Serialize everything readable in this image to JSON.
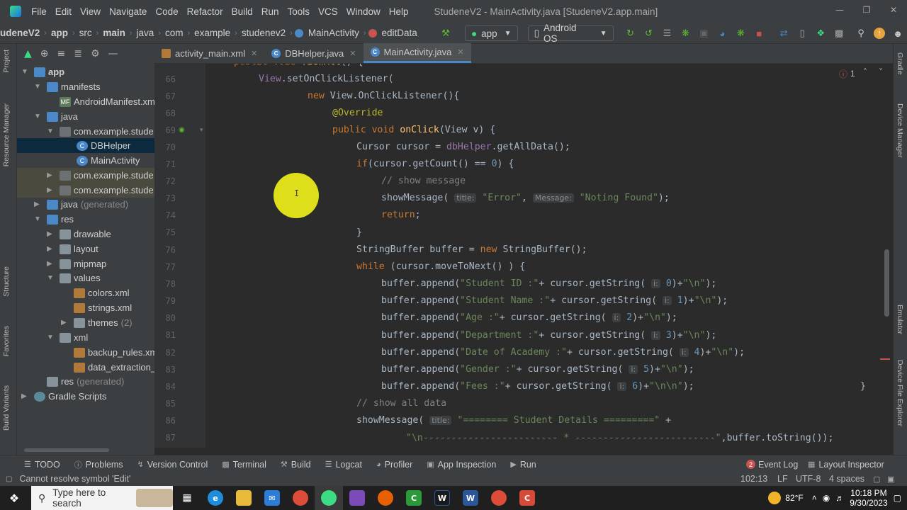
{
  "window": {
    "menu": [
      "File",
      "Edit",
      "View",
      "Navigate",
      "Code",
      "Refactor",
      "Build",
      "Run",
      "Tools",
      "VCS",
      "Window",
      "Help"
    ],
    "title": "StudeneV2 - MainActivity.java [StudeneV2.app.main]"
  },
  "navbar": {
    "crumbs": [
      "udeneV2",
      "app",
      "src",
      "main",
      "java",
      "com",
      "example",
      "studenev2",
      "MainActivity",
      "editData"
    ],
    "run_config": "app",
    "device": "Android OS"
  },
  "left_stripe": {
    "tabs": [
      "Project",
      "Resource Manager",
      "Structure",
      "Favorites",
      "Build Variants"
    ]
  },
  "right_stripe": {
    "tabs": [
      "Gradle",
      "Device Manager",
      "Emulator",
      "Device File Explorer"
    ]
  },
  "project_tree": [
    {
      "label": "app",
      "bold": true
    },
    {
      "label": "manifests"
    },
    {
      "label": "AndroidManifest.xml"
    },
    {
      "label": "java"
    },
    {
      "label": "com.example.stude"
    },
    {
      "label": "DBHelper"
    },
    {
      "label": "MainActivity"
    },
    {
      "label": "com.example.stude"
    },
    {
      "label": "com.example.stude"
    },
    {
      "label": "java",
      "gen": "(generated)"
    },
    {
      "label": "res"
    },
    {
      "label": "drawable"
    },
    {
      "label": "layout"
    },
    {
      "label": "mipmap"
    },
    {
      "label": "values"
    },
    {
      "label": "colors.xml"
    },
    {
      "label": "strings.xml"
    },
    {
      "label": "themes",
      "gen": "(2)"
    },
    {
      "label": "xml"
    },
    {
      "label": "backup_rules.xml"
    },
    {
      "label": "data_extraction_"
    },
    {
      "label": "res",
      "gen": "(generated)"
    },
    {
      "label": "Gradle Scripts"
    }
  ],
  "tabs": [
    {
      "label": "activity_main.xml"
    },
    {
      "label": "DBHelper.java"
    },
    {
      "label": "MainActivity.java",
      "active": true
    }
  ],
  "editor": {
    "inspection_count": "1",
    "line_numbers": [
      "66",
      "67",
      "68",
      "69",
      "70",
      "71",
      "72",
      "73",
      "74",
      "75",
      "76",
      "77",
      "78",
      "79",
      "80",
      "81",
      "82",
      "83",
      "84",
      "85",
      "86",
      "87"
    ],
    "top_partial": "public void viewAll() {"
  },
  "toolwindows": [
    "TODO",
    "Problems",
    "Version Control",
    "Terminal",
    "Build",
    "Logcat",
    "Profiler",
    "App Inspection",
    "Run",
    "Event Log",
    "Layout Inspector"
  ],
  "event_log_count": "2",
  "status": {
    "message": "Cannot resolve symbol 'Edit'",
    "position": "102:13",
    "line_sep": "LF",
    "encoding": "UTF-8",
    "indent": "4 spaces"
  },
  "taskbar": {
    "search_placeholder": "Type here to search",
    "weather": "82°F",
    "time": "10:18 PM",
    "date": "9/30/2023"
  }
}
